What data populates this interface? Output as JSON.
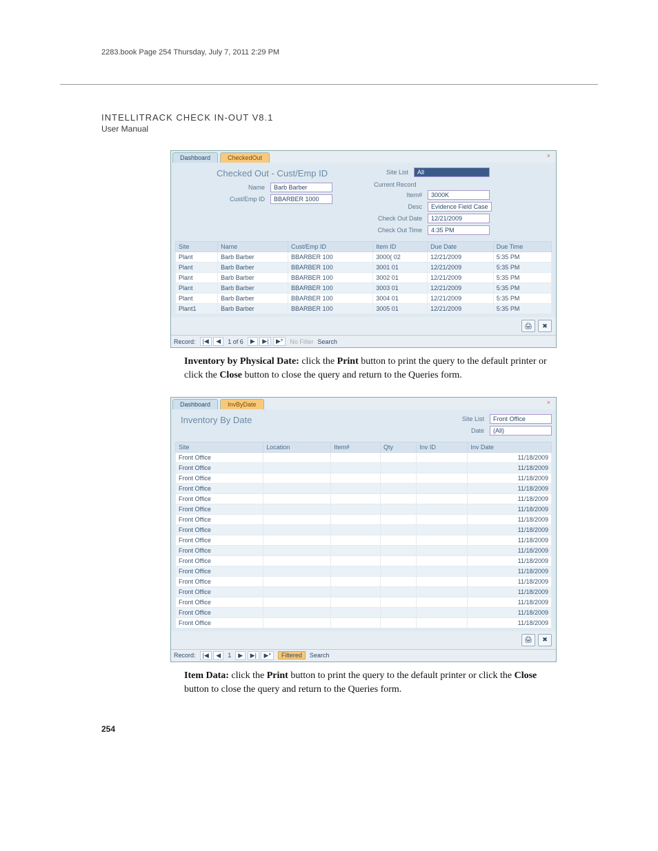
{
  "crop_header": "2283.book  Page 254  Thursday, July 7, 2011  2:29 PM",
  "manual_title": "INTELLITRACK CHECK IN-OUT V8.1",
  "manual_sub": "User Manual",
  "page_number": "254",
  "shot1": {
    "tabs": [
      "Dashboard",
      "CheckedOut"
    ],
    "title": "Checked Out - Cust/Emp ID",
    "site_list_label": "Site List",
    "site_list_value": "All",
    "name_label": "Name",
    "name_value": "Barb Barber",
    "cust_label": "Cust/Emp ID",
    "cust_value": "BBARBER 1000",
    "current_record_heading": "Current Record",
    "item_num_label": "Item#",
    "item_num_value": "3000K",
    "desc_label": "Desc",
    "desc_value": "Evidence Field Case",
    "co_date_label": "Check Out Date",
    "co_date_value": "12/21/2009",
    "co_time_label": "Check Out Time",
    "co_time_value": "4:35 PM",
    "columns": [
      "Site",
      "Name",
      "Cust/Emp ID",
      "Item ID",
      "Due Date",
      "Due Time"
    ],
    "rows": [
      [
        "Plant",
        "Barb Barber",
        "BBARBER 100(3000( 02",
        "12/21/2009",
        "5:35 PM"
      ],
      [
        "Plant",
        "Barb Barber",
        "BBARBER 100(3001 01",
        "12/21/2009",
        "5:35 PM"
      ],
      [
        "Plant",
        "Barb Barber",
        "BBARBER 100(3002 01",
        "12/21/2009",
        "5:35 PM"
      ],
      [
        "Plant",
        "Barb Barber",
        "BBARBER 100(3003 01",
        "12/21/2009",
        "5:35 PM"
      ],
      [
        "Plant",
        "Barb Barber",
        "BBARBER 100(3004 01",
        "12/21/2009",
        "5:35 PM"
      ],
      [
        "Plant1",
        "Barb Barber",
        "BBARBER 100(3005 01",
        "12/21/2009",
        "5:35 PM"
      ]
    ],
    "record_label": "Record:",
    "record_pos": "1 of 6",
    "nav_first": "|◀",
    "nav_prev": "◀",
    "nav_next": "▶",
    "nav_last": "▶|",
    "nav_new": "▶*",
    "no_filter": "No Filter",
    "search_label": "Search",
    "print_icon": "🖨",
    "close_icon": "✖"
  },
  "para1_a": "Inventory by Physical Date: ",
  "para1_b": "click the ",
  "para1_c": "Print",
  "para1_d": " button to print the query to the default printer or click the ",
  "para1_e": "Close",
  "para1_f": " button to close the query and return to the Queries form.",
  "shot2": {
    "tabs": [
      "Dashboard",
      "InvByDate"
    ],
    "title": "Inventory By Date",
    "site_list_label": "Site List",
    "site_list_value": "Front Office",
    "date_label": "Date",
    "date_value": "(All)",
    "columns": [
      "Site",
      "Location",
      "Item#",
      "Qty",
      "Inv ID",
      "Inv Date"
    ],
    "row_site": "Front Office",
    "row_date": "11/18/2009",
    "row_count": 17,
    "record_label": "Record:",
    "record_pos": "1",
    "nav_first": "|◀",
    "nav_prev": "◀",
    "nav_next": "▶",
    "nav_last": "▶|",
    "nav_new": "▶*",
    "filtered": "Filtered",
    "search_label": "Search",
    "print_icon": "🖨",
    "close_icon": "✖"
  },
  "para2_a": "Item Data: ",
  "para2_b": "click the ",
  "para2_c": "Print",
  "para2_d": " button to print the query to the default printer or click the ",
  "para2_e": "Close",
  "para2_f": " button to close the query and return to the Queries form."
}
